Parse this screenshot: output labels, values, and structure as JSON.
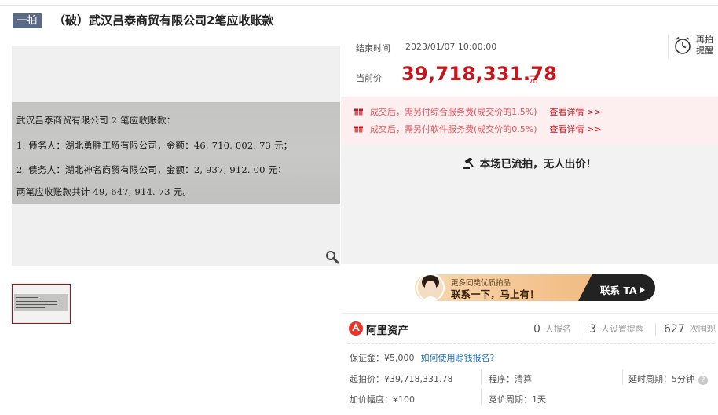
{
  "header": {
    "round_badge": "一拍",
    "title": "（破）武汉吕泰商贸有限公司2笔应收账款"
  },
  "gallery": {
    "document_lines": [
      "武汉吕泰商贸有限公司 2 笔应收账款：",
      "1.  债务人：湖北勇胜工贸有限公司，金额：46, 710, 002. 73 元；",
      "2.  债务人：湖北神名商贸有限公司，金额：2, 937, 912. 00 元；",
      "两笔应收账款共计 49, 647, 914. 73 元。"
    ],
    "zoom_icon": "magnifier-icon"
  },
  "auction": {
    "end_label": "结束时间",
    "end_time": "2023/01/07 10:00:00",
    "remind_label": "再拍提醒",
    "price_label": "当前价",
    "price": "39,718,331.78",
    "price_unit": "元",
    "fees": [
      {
        "text": "成交后，需另付综合服务费(成交价的1.5%)",
        "link": "查看详情 >>"
      },
      {
        "text": "成交后，需另付软件服务费(成交价的0.5%)",
        "link": "查看详情 >>"
      }
    ],
    "status": "本场已流拍，无人出价！",
    "colors": {
      "price_red": "#c5161d",
      "badge": "#5a6a86",
      "fee_bg": "#fdeef0"
    }
  },
  "contact": {
    "subtitle": "更多同类优质拍品",
    "main": "联系一下，马上有！",
    "cta": "联系 TA"
  },
  "platform": {
    "name": "阿里资产",
    "stats": [
      {
        "num": "0",
        "label": "人报名"
      },
      {
        "num": "3",
        "label": "人设置提醒"
      },
      {
        "num": "627",
        "label": "次围观"
      }
    ]
  },
  "details": {
    "deposit": "保证金：¥5,000",
    "deposit_link": "如何使用赊钱报名?",
    "start_price": "起拍价：¥39,718,331.78",
    "procedure": "程序：清算",
    "delay": "延时周期：5分钟",
    "increment": "加价幅度：¥100",
    "bid_period": "竞价周期：1天"
  }
}
